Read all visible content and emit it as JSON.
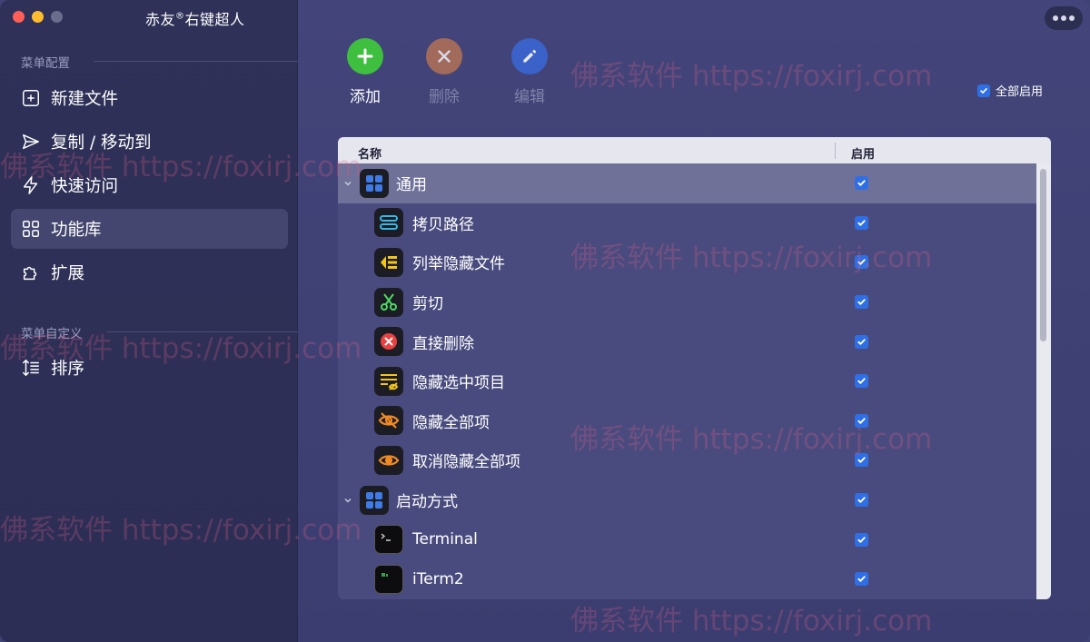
{
  "window": {
    "title": "赤友",
    "title_mark": "®",
    "title_rest": "右键超人"
  },
  "sidebar": {
    "section_config": "菜单配置",
    "section_custom": "菜单自定义",
    "items": [
      {
        "label": "新建文件",
        "icon": "new-file-icon"
      },
      {
        "label": "复制 / 移动到",
        "icon": "send-icon"
      },
      {
        "label": "快速访问",
        "icon": "bolt-icon"
      },
      {
        "label": "功能库",
        "icon": "grid-icon",
        "active": true
      },
      {
        "label": "扩展",
        "icon": "puzzle-icon"
      }
    ],
    "custom_items": [
      {
        "label": "排序",
        "icon": "sort-icon"
      }
    ]
  },
  "toolbar": {
    "add_label": "添加",
    "delete_label": "删除",
    "edit_label": "编辑",
    "enable_all_label": "全部启用",
    "enable_all_checked": true
  },
  "table": {
    "col_name": "名称",
    "col_enable": "启用",
    "rows": [
      {
        "label": "通用",
        "group": true,
        "icon": "grid-icon",
        "enabled": true,
        "selected": true
      },
      {
        "label": "拷贝路径",
        "icon": "path-icon",
        "enabled": true
      },
      {
        "label": "列举隐藏文件",
        "icon": "list-hidden-icon",
        "enabled": true
      },
      {
        "label": "剪切",
        "icon": "scissors-icon",
        "enabled": true
      },
      {
        "label": "直接删除",
        "icon": "delete-icon",
        "enabled": true
      },
      {
        "label": "隐藏选中项目",
        "icon": "hide-selected-icon",
        "enabled": true
      },
      {
        "label": "隐藏全部项",
        "icon": "hide-all-icon",
        "enabled": true
      },
      {
        "label": "取消隐藏全部项",
        "icon": "show-all-icon",
        "enabled": true
      },
      {
        "label": "启动方式",
        "group": true,
        "icon": "grid-icon",
        "enabled": true
      },
      {
        "label": "Terminal",
        "icon": "terminal-icon",
        "enabled": true
      },
      {
        "label": "iTerm2",
        "icon": "iterm-icon",
        "enabled": true
      }
    ]
  },
  "watermark": "佛系软件 https://foxirj.com",
  "colors": {
    "accent": "#2e6fe6",
    "add": "#3fbf3f",
    "delete": "#a26a5a",
    "edit": "#3a62c8"
  }
}
